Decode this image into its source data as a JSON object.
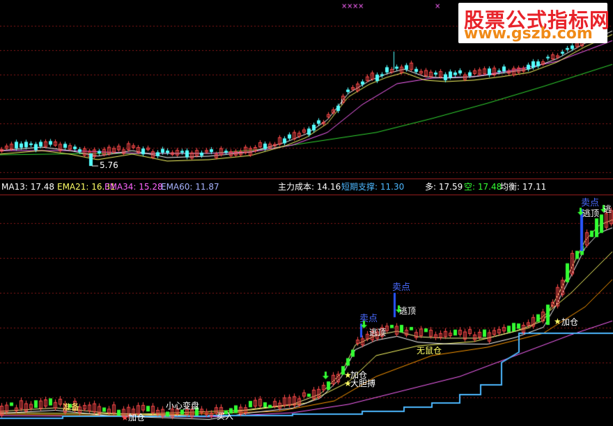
{
  "watermark": {
    "line1": "股票公式指标网",
    "line2": "www.gszb.com"
  },
  "indicator_bar": {
    "ma13": "MA13: 17.48",
    "ema21": "EMA21: 16.31",
    "ema34": "EMA34: 15.28",
    "ema60": "EMA60: 11.87",
    "main_cost": "主力成本: 14.16",
    "short_support": "短期支撑: 11.30",
    "long": "多: 17.59",
    "short": "空: 17.48",
    "balance": "均衡: 17.11"
  },
  "markers": {
    "low_price": "5.76",
    "sell_1": "卖点",
    "sell_2": "卖点",
    "sell_3": "卖点",
    "escape_1": "逃顶",
    "escape_2": "逃顶",
    "escape_3": "逃顶",
    "escape_4": "逃",
    "add_1": "加仓",
    "add_2": "加仓",
    "add_3": "加仓",
    "bold_buy": "大胆搏",
    "no_position": "无鼠仓",
    "careful_change": "小心变盘",
    "prepare": "准备",
    "buy": "买入"
  },
  "colors": {
    "up": "#ff4a4a",
    "down": "#54ffff",
    "ma13": "#ffffff",
    "ema21": "#ffff66",
    "ema34": "#ff66ff",
    "ema60": "#33dd33",
    "support": "#4db8ff",
    "green_bar": "#33ff33"
  }
}
